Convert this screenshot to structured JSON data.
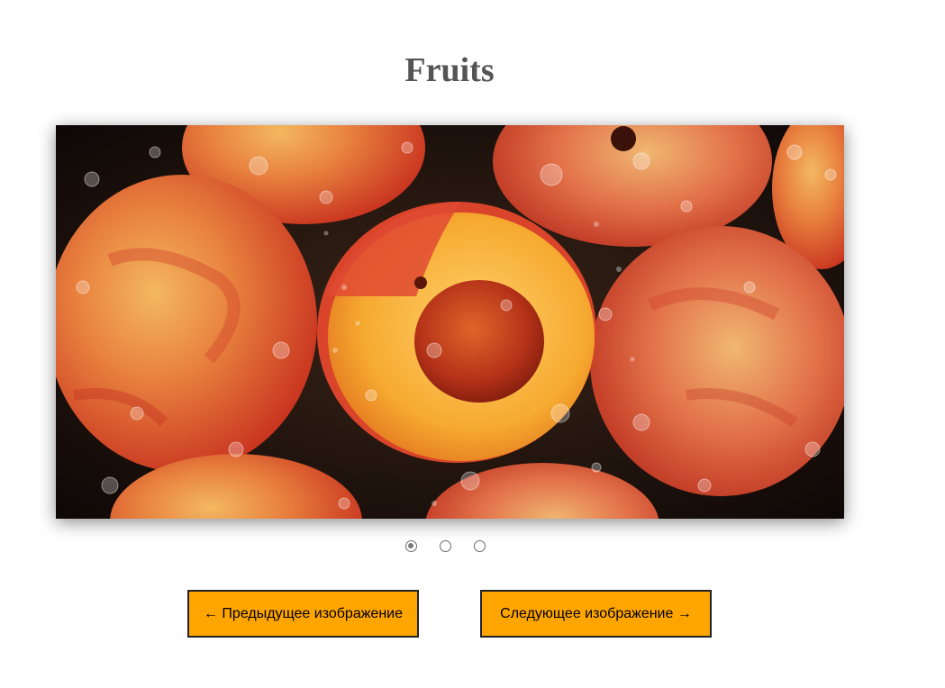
{
  "page": {
    "title": "Fruits"
  },
  "slider": {
    "image": {
      "subject": "peaches-in-water",
      "colors": {
        "skin_red": "#d8432a",
        "skin_yellow": "#f2a63c",
        "flesh": "#f7b43a",
        "pit": "#b8361a",
        "background": "#1a0d08"
      }
    },
    "indicators": {
      "count": 3,
      "selected_index": 0
    }
  },
  "buttons": {
    "prev_label": "← Предыдущее изображение",
    "next_label": "Следующее изображение →"
  },
  "colors": {
    "title": "#555555",
    "button_bg": "#ffa500",
    "button_border": "#222222"
  }
}
